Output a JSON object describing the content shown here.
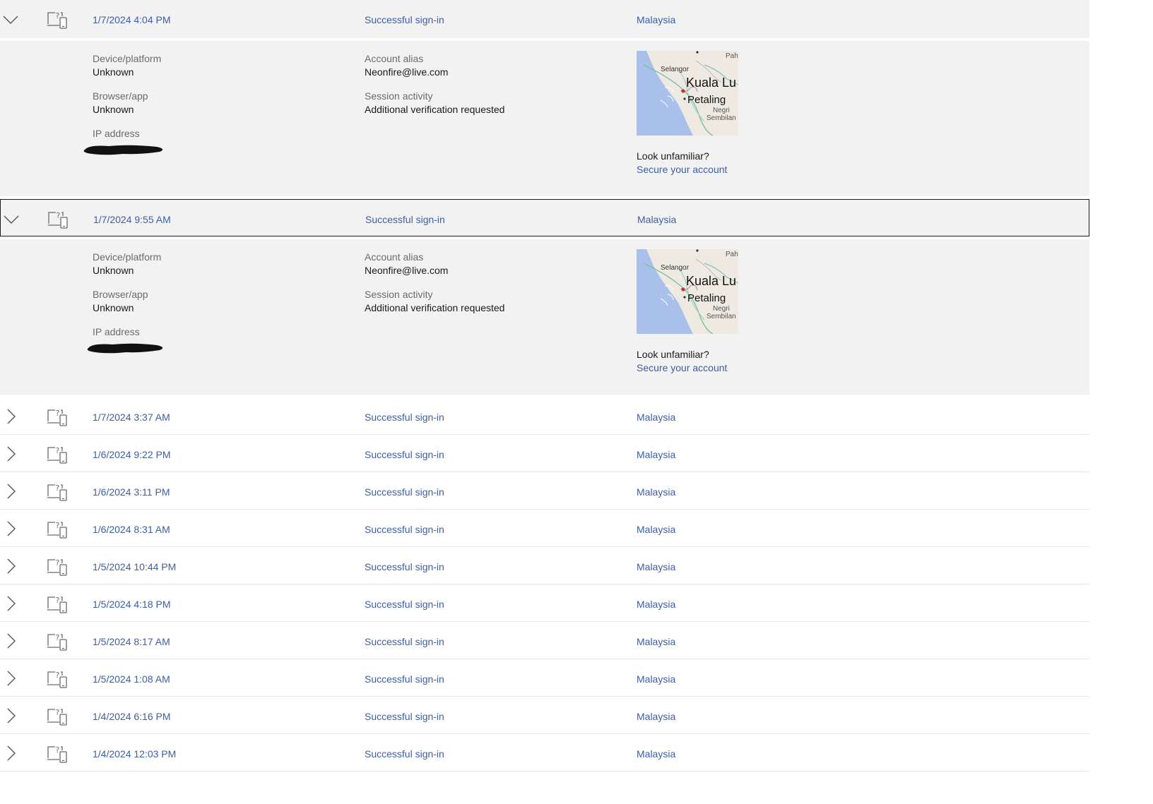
{
  "icons": {
    "expanded_chevron": "chevron-down-icon",
    "collapsed_chevron": "chevron-right-icon",
    "device": "unknown-device-icon"
  },
  "colors": {
    "link": "#3c5ea8",
    "expanded_bg": "#f2f2f2",
    "label": "#6b6b6b"
  },
  "rows": [
    {
      "date": "1/7/2024 4:04 PM",
      "activity": "Successful sign-in",
      "location": "Malaysia",
      "expanded": true,
      "details": {
        "device_label": "Device/platform",
        "device_value": "Unknown",
        "browser_label": "Browser/app",
        "browser_value": "Unknown",
        "ip_label": "IP address",
        "alias_label": "Account alias",
        "alias_value": "Neonfire@live.com",
        "session_label": "Session activity",
        "session_value": "Additional verification requested",
        "map_labels": {
          "state_a": "Selangor",
          "city_main": "Kuala Lu",
          "city_b": "Petaling",
          "state_b_1": "Negri",
          "state_b_2": "Sembilan",
          "corner": "Pah"
        },
        "unfamiliar_text": "Look unfamiliar?",
        "secure_link": "Secure your account"
      }
    },
    {
      "date": "1/7/2024 9:55 AM",
      "activity": "Successful sign-in",
      "location": "Malaysia",
      "expanded": true,
      "focused": true,
      "details": {
        "device_label": "Device/platform",
        "device_value": "Unknown",
        "browser_label": "Browser/app",
        "browser_value": "Unknown",
        "ip_label": "IP address",
        "alias_label": "Account alias",
        "alias_value": "Neonfire@live.com",
        "session_label": "Session activity",
        "session_value": "Additional verification requested",
        "map_labels": {
          "state_a": "Selangor",
          "city_main": "Kuala Lu",
          "city_b": "Petaling",
          "state_b_1": "Negri",
          "state_b_2": "Sembilan",
          "corner": "Pah"
        },
        "unfamiliar_text": "Look unfamiliar?",
        "secure_link": "Secure your account"
      }
    },
    {
      "date": "1/7/2024 3:37 AM",
      "activity": "Successful sign-in",
      "location": "Malaysia"
    },
    {
      "date": "1/6/2024 9:22 PM",
      "activity": "Successful sign-in",
      "location": "Malaysia"
    },
    {
      "date": "1/6/2024 3:11 PM",
      "activity": "Successful sign-in",
      "location": "Malaysia"
    },
    {
      "date": "1/6/2024 8:31 AM",
      "activity": "Successful sign-in",
      "location": "Malaysia"
    },
    {
      "date": "1/5/2024 10:44 PM",
      "activity": "Successful sign-in",
      "location": "Malaysia"
    },
    {
      "date": "1/5/2024 4:18 PM",
      "activity": "Successful sign-in",
      "location": "Malaysia"
    },
    {
      "date": "1/5/2024 8:17 AM",
      "activity": "Successful sign-in",
      "location": "Malaysia"
    },
    {
      "date": "1/5/2024 1:08 AM",
      "activity": "Successful sign-in",
      "location": "Malaysia"
    },
    {
      "date": "1/4/2024 6:16 PM",
      "activity": "Successful sign-in",
      "location": "Malaysia"
    },
    {
      "date": "1/4/2024 12:03 PM",
      "activity": "Successful sign-in",
      "location": "Malaysia"
    }
  ]
}
